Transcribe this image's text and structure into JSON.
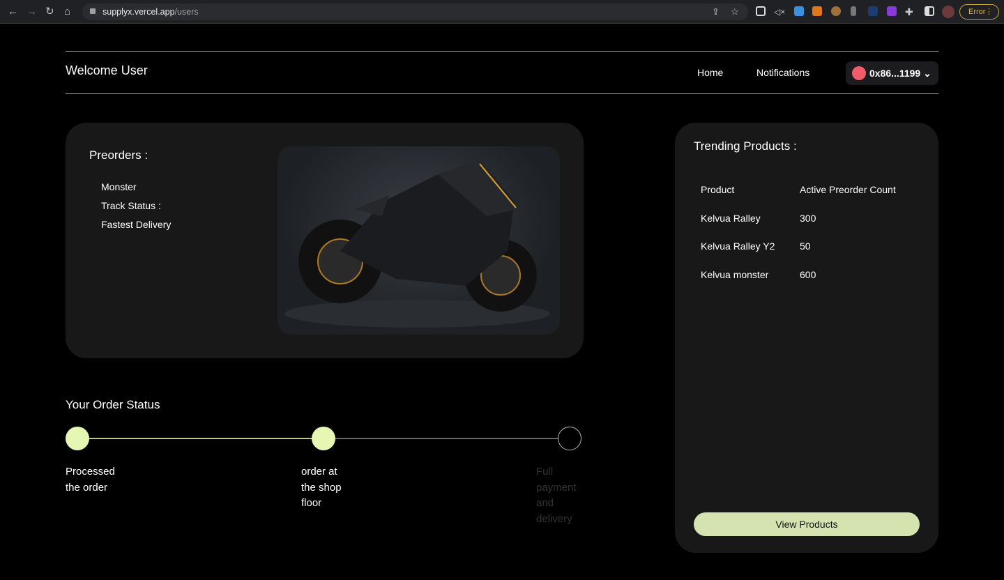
{
  "browser": {
    "url_host": "supplyx.vercel.app",
    "url_path": "/users",
    "error_label": "Error"
  },
  "header": {
    "title": "Welcome User",
    "nav": [
      "Home",
      "Notifications"
    ],
    "wallet": "0x86...1199"
  },
  "preorders": {
    "title": "Preorders :",
    "items": [
      "Monster",
      "Track Status :",
      "Fastest Delivery"
    ]
  },
  "order_status": {
    "title": "Your Order Status",
    "steps": [
      {
        "label": [
          "Processed",
          "the order"
        ],
        "done": true
      },
      {
        "label": [
          "order at",
          "the shop",
          "floor"
        ],
        "done": true
      },
      {
        "label": [
          "Full",
          "payment",
          "and",
          "delivery"
        ],
        "done": false
      }
    ],
    "accent": "#e6f7b4"
  },
  "trending": {
    "title": "Trending Products :",
    "headers": [
      "Product",
      "Active Preorder Count"
    ],
    "rows": [
      [
        "Kelvua Ralley",
        "300"
      ],
      [
        "Kelvua Ralley Y2",
        "50"
      ],
      [
        "Kelvua monster",
        "600"
      ]
    ],
    "button": "View Products"
  }
}
